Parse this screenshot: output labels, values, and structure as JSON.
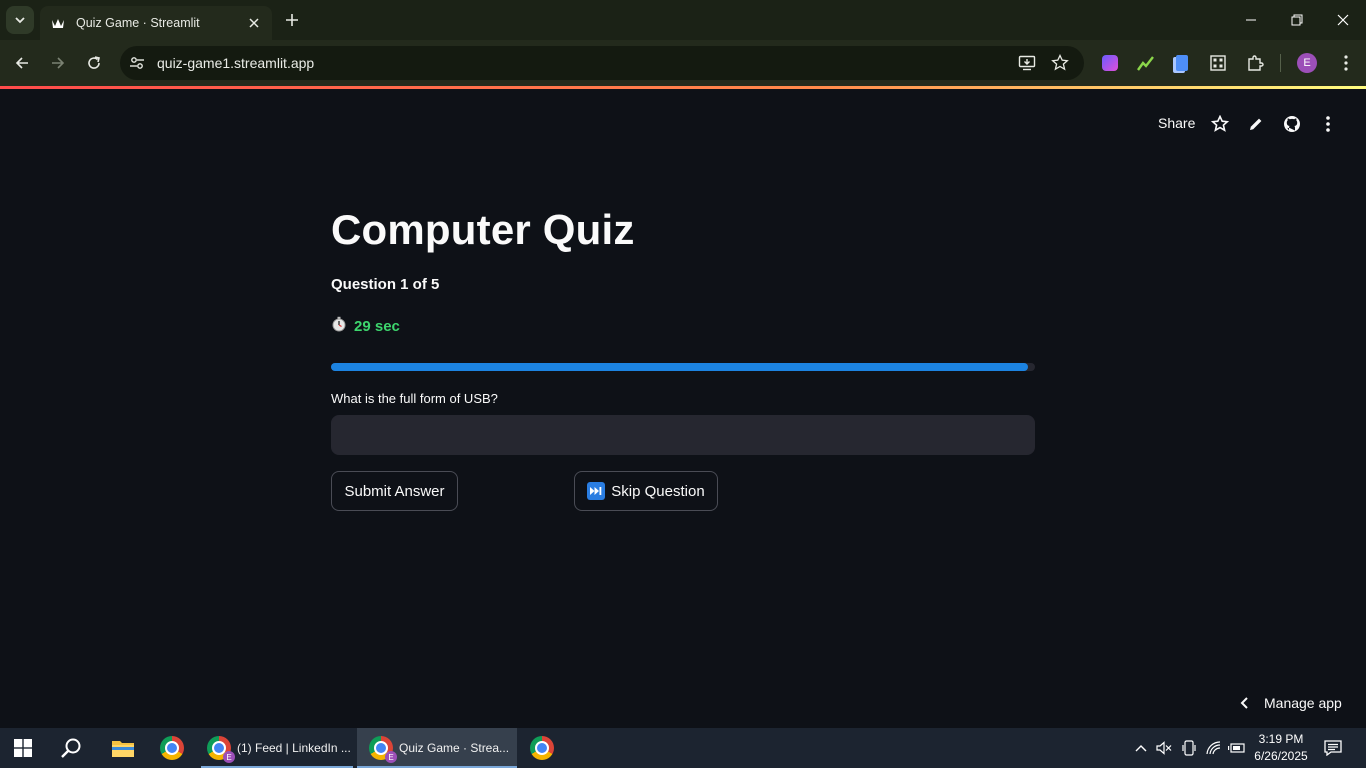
{
  "browser": {
    "tab_title": "Quiz Game · Streamlit",
    "url": "quiz-game1.streamlit.app",
    "profile_initial": "E"
  },
  "header": {
    "share_label": "Share"
  },
  "main": {
    "title": "Computer Quiz",
    "question_count": "Question 1 of 5",
    "timer_text": "29 sec",
    "progress_fraction": 0.99,
    "question_label": "What is the full form of USB?",
    "answer_value": "",
    "submit_label": "Submit Answer",
    "skip_label": "Skip Question"
  },
  "footer": {
    "manage_label": "Manage app"
  },
  "taskbar": {
    "apps": [
      {
        "label": "(1) Feed | LinkedIn ...",
        "badge": "E"
      },
      {
        "label": "Quiz Game · Strea...",
        "badge": "E"
      }
    ],
    "time": "3:19 PM",
    "date": "6/26/2025"
  },
  "colors": {
    "background": "#0e1117",
    "progress": "#1c83e1",
    "timer": "#3dd56d",
    "input_bg": "#262730"
  }
}
